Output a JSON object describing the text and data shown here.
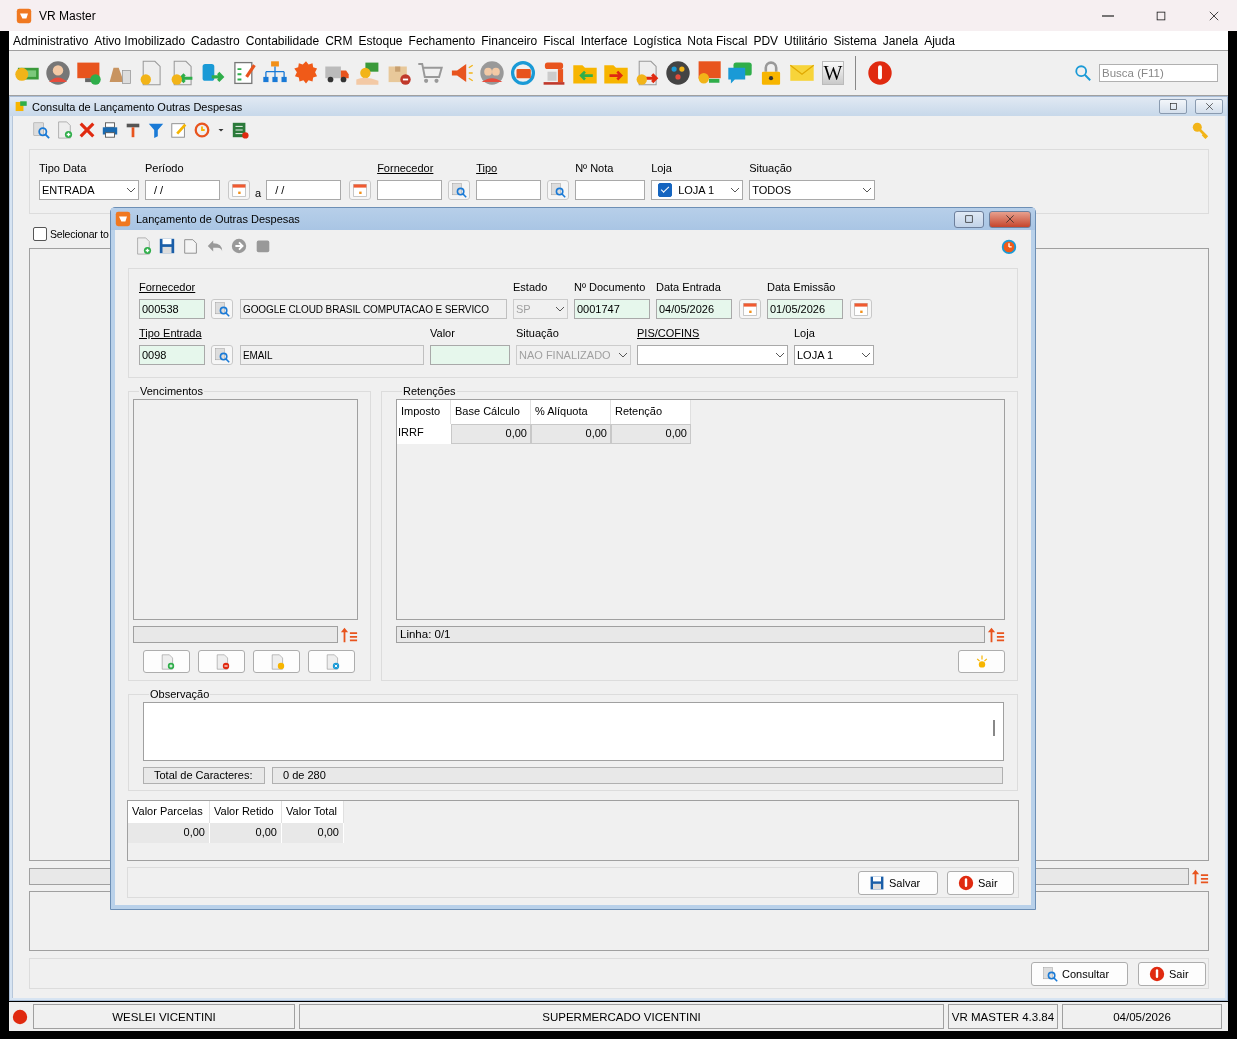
{
  "app": {
    "title": "VR Master"
  },
  "menu": [
    {
      "label": "Administrativo"
    },
    {
      "label": "Ativo Imobilizado"
    },
    {
      "label": "Cadastro"
    },
    {
      "label": "Contabilidade"
    },
    {
      "label": "CRM"
    },
    {
      "label": "Estoque"
    },
    {
      "label": "Fechamento"
    },
    {
      "label": "Financeiro"
    },
    {
      "label": "Fiscal"
    },
    {
      "label": "Interface"
    },
    {
      "label": "Logística"
    },
    {
      "label": "Nota Fiscal"
    },
    {
      "label": "PDV"
    },
    {
      "label": "Utilitário"
    },
    {
      "label": "Sistema"
    },
    {
      "label": "Janela"
    },
    {
      "label": "Ajuda"
    }
  ],
  "toolbar": {
    "wiki_glyph": "W"
  },
  "search": {
    "placeholder": "Busca (F11)"
  },
  "consulta": {
    "title": "Consulta de Lançamento Outras Despesas",
    "filters": [
      {
        "kind": "select",
        "label": "Tipo Data",
        "value": "ENTRADA"
      },
      {
        "kind": "period",
        "label": "Período",
        "from": "/ /",
        "separator": "a",
        "to": "/ /"
      },
      {
        "kind": "lookup",
        "label": "Fornecedor",
        "link": true
      },
      {
        "kind": "lookup",
        "label": "Tipo",
        "link": true
      },
      {
        "kind": "text",
        "label": "Nº Nota"
      },
      {
        "kind": "check_select",
        "label": "Loja",
        "value": "LOJA 1",
        "checked": true
      },
      {
        "kind": "select",
        "label": "Situação",
        "value": "TODOS"
      }
    ],
    "select_all": {
      "label": "Selecionar to",
      "checked": false
    },
    "buttons": [
      {
        "kind": "consult",
        "label": "Consultar"
      },
      {
        "kind": "exit",
        "label": "Sair"
      }
    ]
  },
  "dialog": {
    "title": "Lançamento de Outras Despesas",
    "field_rows": [
      [
        {
          "kind": "lookup",
          "label": "Fornecedor",
          "link": true,
          "code": "000538",
          "description": "GOOGLE CLOUD BRASIL COMPUTACAO E SERVICO"
        },
        {
          "kind": "select",
          "label": "Estado",
          "value": "SP",
          "disabled": true
        },
        {
          "kind": "text",
          "label": "Nº Documento",
          "value": "0001747"
        },
        {
          "kind": "date",
          "label": "Data Entrada",
          "value": "04/05/2026"
        },
        {
          "kind": "date",
          "label": "Data Emissão",
          "value": "01/05/2026"
        }
      ],
      [
        {
          "kind": "lookup",
          "label": "Tipo Entrada",
          "link": true,
          "code": "0098",
          "description": "EMAIL"
        },
        {
          "kind": "text",
          "label": "Valor"
        },
        {
          "kind": "select",
          "label": "Situação",
          "value": "NAO FINALIZADO",
          "disabled": true
        },
        {
          "kind": "select",
          "label": "PIS/COFINS",
          "link": true,
          "disabled": false
        },
        {
          "kind": "select",
          "label": "Loja",
          "value": "LOJA 1",
          "disabled": false
        }
      ]
    ],
    "vencimentos": {
      "title": "Vencimentos"
    },
    "retencoes": {
      "title": "Retenções",
      "columns": [
        "Imposto",
        "Base Cálculo",
        "% Alíquota",
        "Retenção"
      ],
      "rows": [
        [
          "IRRF",
          "0,00",
          "0,00",
          "0,00"
        ]
      ],
      "status": "Linha: 0/1"
    },
    "observacao": {
      "title": "Observação",
      "count_label": "Total de Caracteres:",
      "count": "0 de 280"
    },
    "totals": {
      "columns": [
        "Valor Parcelas",
        "Valor Retido",
        "Valor Total"
      ],
      "values": [
        "0,00",
        "0,00",
        "0,00"
      ]
    },
    "buttons": [
      {
        "kind": "save",
        "label": "Salvar"
      },
      {
        "kind": "exit",
        "label": "Sair"
      }
    ]
  },
  "status_bar": [
    "WESLEI VICENTINI",
    "SUPERMERCADO VICENTINI",
    "VR MASTER 4.3.84",
    "04/05/2026"
  ]
}
